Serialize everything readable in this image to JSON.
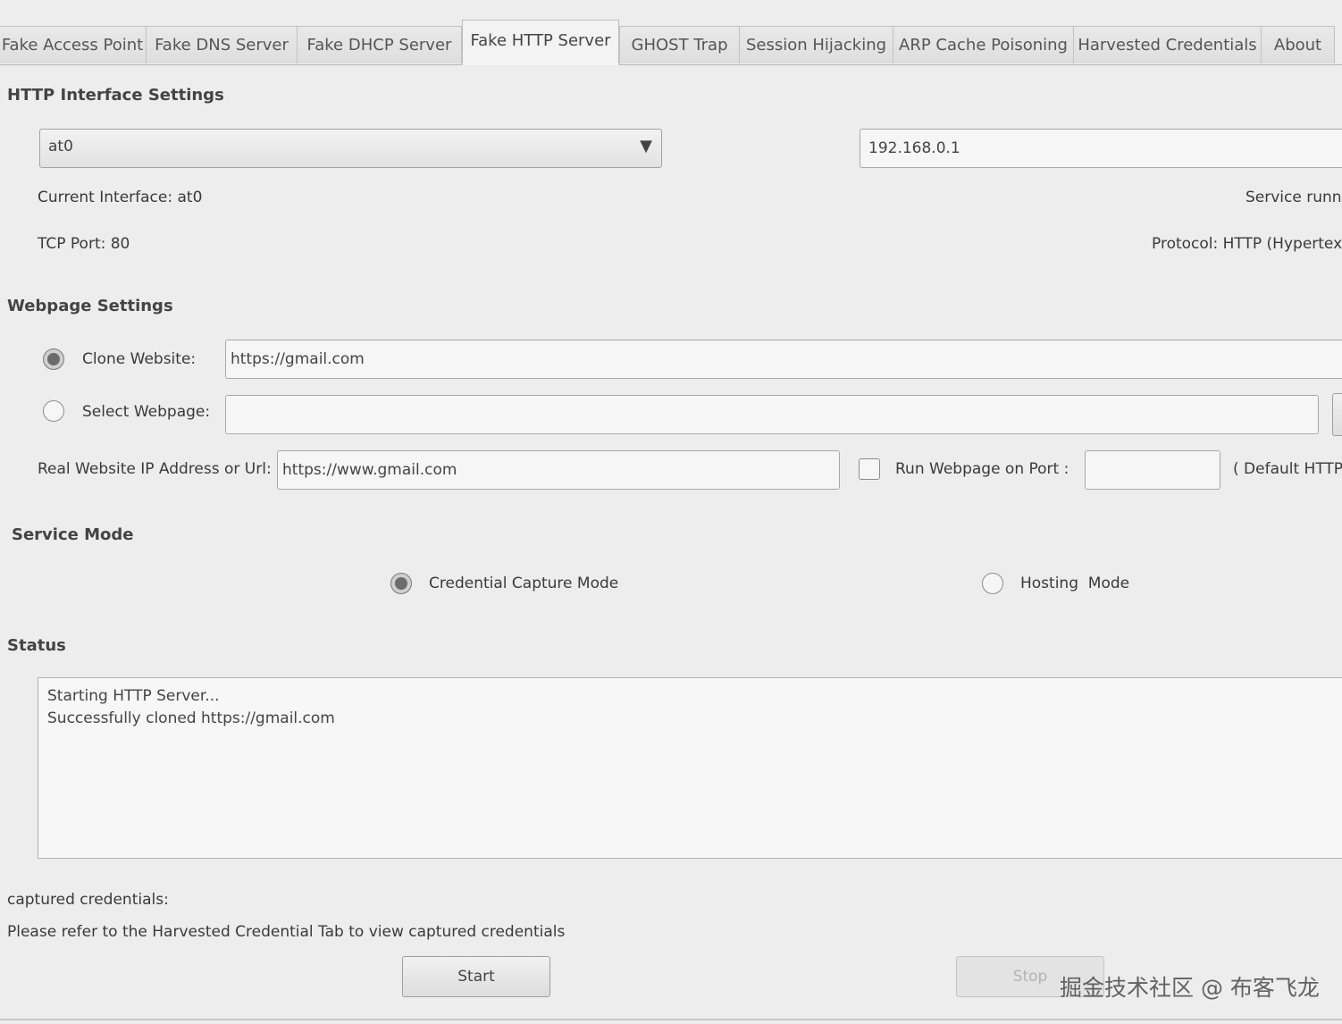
{
  "tabs": [
    {
      "label": "Fake Access Point"
    },
    {
      "label": "Fake DNS Server"
    },
    {
      "label": "Fake DHCP Server"
    },
    {
      "label": "Fake HTTP Server",
      "active": true
    },
    {
      "label": "GHOST Trap"
    },
    {
      "label": "Session Hijacking"
    },
    {
      "label": "ARP Cache Poisoning"
    },
    {
      "label": "Harvested Credentials"
    },
    {
      "label": "About"
    }
  ],
  "http_interface": {
    "heading": "HTTP Interface Settings",
    "interface_selected": "at0",
    "ip_address": "192.168.0.1",
    "current_interface": "Current Interface: at0",
    "service_status": "Service runnir",
    "tcp_port": "TCP Port: 80",
    "protocol": "Protocol: HTTP (Hypertext"
  },
  "webpage": {
    "heading": "Webpage Settings",
    "clone_label": "Clone Website:",
    "clone_value": "https://gmail.com",
    "clone_selected": true,
    "select_label": "Select Webpage:",
    "select_value": "",
    "real_ip_label": "Real Website IP Address or Url:",
    "real_ip_value": "https://www.gmail.com",
    "run_port_label": "Run Webpage on Port :",
    "run_port_value": "",
    "default_note": "( Default HTTP"
  },
  "service_mode": {
    "heading": "Service Mode",
    "credential_label": "Credential Capture Mode",
    "credential_selected": true,
    "hosting_label": "Hosting  Mode"
  },
  "status": {
    "heading": "Status",
    "lines": [
      "Starting HTTP Server...",
      "Successfully cloned https://gmail.com"
    ]
  },
  "credentials": {
    "label": "captured credentials:",
    "note": "Please refer to the Harvested Credential Tab to view captured credentials"
  },
  "buttons": {
    "start": "Start",
    "stop": "Stop"
  },
  "watermark": "掘金技术社区 @ 布客飞龙",
  "icons": {
    "dropdown": "triangle-down"
  }
}
